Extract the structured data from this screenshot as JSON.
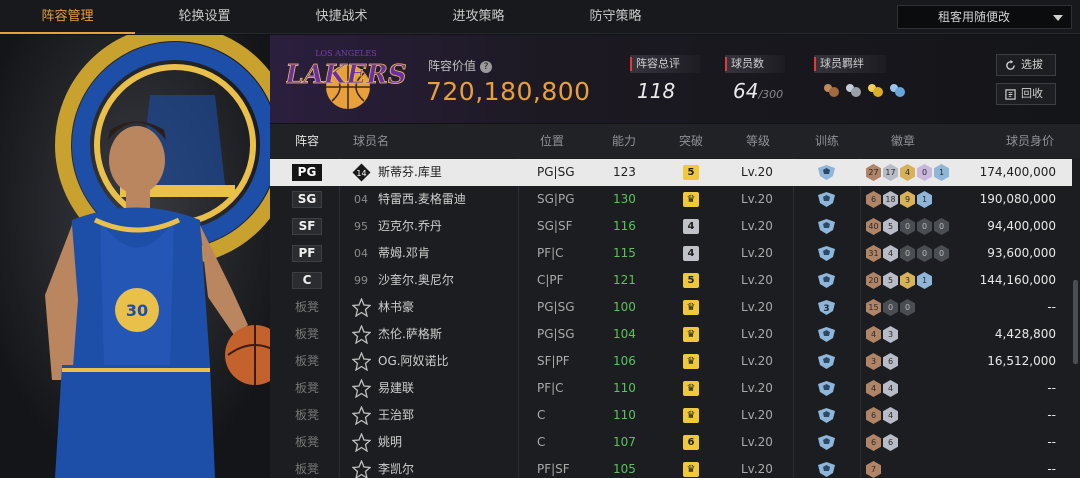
{
  "nav": {
    "tabs": [
      {
        "label": "阵容管理",
        "active": true
      },
      {
        "label": "轮换设置",
        "active": false
      },
      {
        "label": "快捷战术",
        "active": false
      },
      {
        "label": "进攻策略",
        "active": false
      },
      {
        "label": "防守策略",
        "active": false
      }
    ],
    "dropdown_value": "租客用随便改"
  },
  "team": {
    "logo_text": "LAKERS",
    "logo_city": "LOS ANGELES",
    "value_label": "阵容价值",
    "value": "720,180,800",
    "overall_label": "阵容总评",
    "overall": "118",
    "players_label": "球员数",
    "players": "64",
    "players_max": "/300",
    "synergy_label": "球员羁绊",
    "btn_select": "选拔",
    "btn_recycle": "回收"
  },
  "table": {
    "headers": [
      "阵容",
      "球员名",
      "位置",
      "能力",
      "突破",
      "等级",
      "训练",
      "徽章",
      "球员身价"
    ],
    "rows": [
      {
        "slot": "PG",
        "bench": false,
        "num": "14",
        "name": "斯蒂芬.库里",
        "pos": "PG|SG",
        "ability": "123",
        "tp": "5",
        "tp_color": "#f0c93a",
        "level": "Lv.20",
        "train": "",
        "badges": [
          [
            "27",
            "br"
          ],
          [
            "17",
            "sv"
          ],
          [
            "4",
            "gd"
          ],
          [
            "0",
            "pu"
          ],
          [
            "1",
            "bl"
          ]
        ],
        "price": "174,400,000",
        "selected": true
      },
      {
        "slot": "SG",
        "bench": false,
        "num": "04",
        "name": "特雷西.麦格雷迪",
        "pos": "SG|PG",
        "ability": "130",
        "tp": "♛",
        "tp_color": "#f0c93a",
        "level": "Lv.20",
        "train": "",
        "badges": [
          [
            "6",
            "br"
          ],
          [
            "18",
            "sv"
          ],
          [
            "9",
            "gd"
          ],
          [
            "1",
            "bl"
          ]
        ],
        "price": "190,080,000"
      },
      {
        "slot": "SF",
        "bench": false,
        "num": "95",
        "name": "迈克尔.乔丹",
        "pos": "SG|SF",
        "ability": "116",
        "tp": "4",
        "tp_color": "#bfc3c9",
        "level": "Lv.20",
        "train": "",
        "badges": [
          [
            "40",
            "br"
          ],
          [
            "5",
            "sv"
          ],
          [
            "0",
            "dk"
          ],
          [
            "0",
            "dk"
          ],
          [
            "0",
            "dk"
          ]
        ],
        "price": "94,400,000"
      },
      {
        "slot": "PF",
        "bench": false,
        "num": "04",
        "name": "蒂姆.邓肯",
        "pos": "PF|C",
        "ability": "115",
        "tp": "4",
        "tp_color": "#bfc3c9",
        "level": "Lv.20",
        "train": "",
        "badges": [
          [
            "31",
            "br"
          ],
          [
            "4",
            "sv"
          ],
          [
            "0",
            "dk"
          ],
          [
            "0",
            "dk"
          ],
          [
            "0",
            "dk"
          ]
        ],
        "price": "93,600,000"
      },
      {
        "slot": "C",
        "bench": false,
        "num": "99",
        "name": "沙奎尔.奥尼尔",
        "pos": "C|PF",
        "ability": "121",
        "tp": "5",
        "tp_color": "#f0c93a",
        "level": "Lv.20",
        "train": "",
        "badges": [
          [
            "20",
            "br"
          ],
          [
            "5",
            "sv"
          ],
          [
            "3",
            "gd"
          ],
          [
            "1",
            "bl"
          ]
        ],
        "price": "144,160,000"
      },
      {
        "slot": "板凳",
        "bench": true,
        "num": "",
        "name": "林书豪",
        "pos": "PG|SG",
        "ability": "100",
        "tp": "♛",
        "tp_color": "#f0c93a",
        "level": "Lv.20",
        "train": "3",
        "badges": [
          [
            "15",
            "br"
          ],
          [
            "0",
            "dk"
          ],
          [
            "0",
            "dk"
          ]
        ],
        "price": "--"
      },
      {
        "slot": "板凳",
        "bench": true,
        "num": "",
        "name": "杰伦.萨格斯",
        "pos": "PG|SG",
        "ability": "104",
        "tp": "♛",
        "tp_color": "#f0c93a",
        "level": "Lv.20",
        "train": "",
        "badges": [
          [
            "4",
            "br"
          ],
          [
            "3",
            "sv"
          ]
        ],
        "price": "4,428,800"
      },
      {
        "slot": "板凳",
        "bench": true,
        "num": "",
        "name": "OG.阿奴诺比",
        "pos": "SF|PF",
        "ability": "106",
        "tp": "♛",
        "tp_color": "#f0c93a",
        "level": "Lv.20",
        "train": "",
        "badges": [
          [
            "3",
            "br"
          ],
          [
            "6",
            "sv"
          ]
        ],
        "price": "16,512,000"
      },
      {
        "slot": "板凳",
        "bench": true,
        "num": "",
        "name": "易建联",
        "pos": "PF|C",
        "ability": "110",
        "tp": "♛",
        "tp_color": "#f0c93a",
        "level": "Lv.20",
        "train": "",
        "badges": [
          [
            "4",
            "br"
          ],
          [
            "4",
            "sv"
          ]
        ],
        "price": "--"
      },
      {
        "slot": "板凳",
        "bench": true,
        "num": "",
        "name": "王治郅",
        "pos": "C",
        "ability": "110",
        "tp": "♛",
        "tp_color": "#f0c93a",
        "level": "Lv.20",
        "train": "",
        "badges": [
          [
            "6",
            "br"
          ],
          [
            "4",
            "sv"
          ]
        ],
        "price": "--"
      },
      {
        "slot": "板凳",
        "bench": true,
        "num": "",
        "name": "姚明",
        "pos": "C",
        "ability": "107",
        "tp": "6",
        "tp_color": "#f0c93a",
        "level": "Lv.20",
        "train": "",
        "badges": [
          [
            "6",
            "br"
          ],
          [
            "6",
            "sv"
          ]
        ],
        "price": "--"
      },
      {
        "slot": "板凳",
        "bench": true,
        "num": "",
        "name": "李凯尔",
        "pos": "PF|SF",
        "ability": "105",
        "tp": "♛",
        "tp_color": "#f0c93a",
        "level": "Lv.20",
        "train": "",
        "badges": [
          [
            "7",
            "br"
          ]
        ],
        "price": "--"
      }
    ]
  },
  "icons": {
    "help": "question-icon",
    "select": "refresh-icon",
    "recycle": "recycle-icon",
    "training": "shield-icon"
  }
}
